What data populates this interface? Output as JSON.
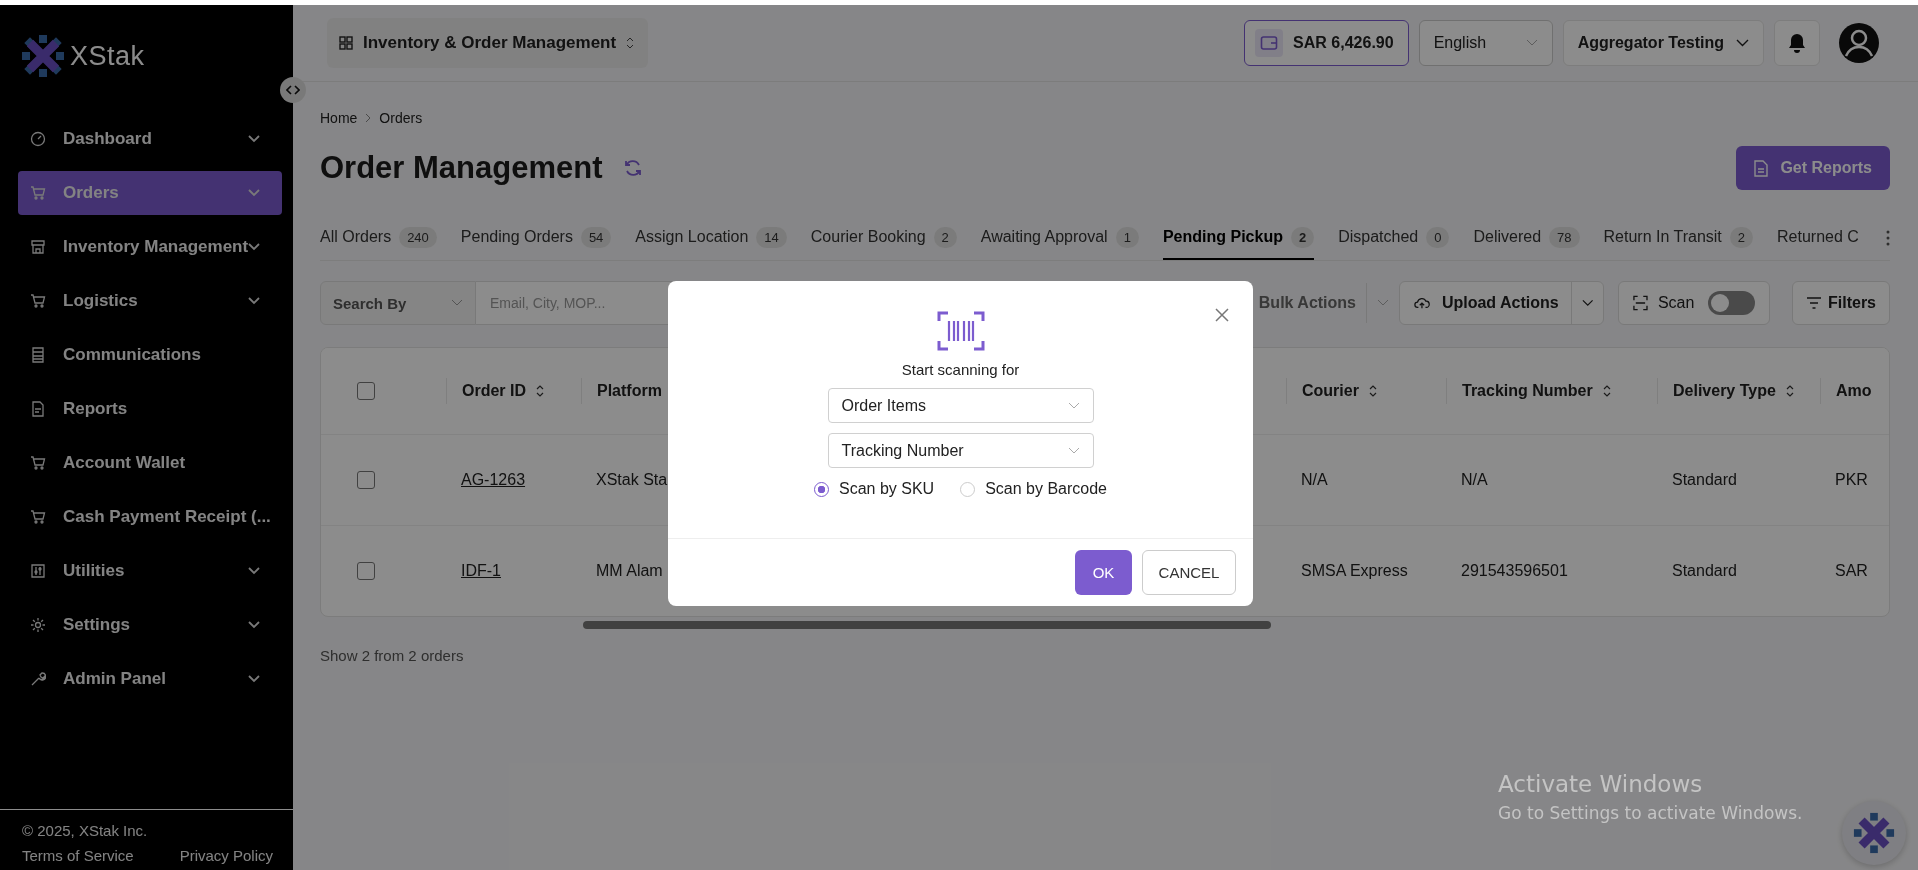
{
  "sidebar": {
    "logo": "XStak",
    "items": [
      {
        "label": "Dashboard",
        "expandable": true,
        "selected": false
      },
      {
        "label": "Orders",
        "expandable": true,
        "selected": true
      },
      {
        "label": "Inventory Management",
        "expandable": true,
        "selected": false
      },
      {
        "label": "Logistics",
        "expandable": true,
        "selected": false
      },
      {
        "label": "Communications",
        "expandable": false,
        "selected": false
      },
      {
        "label": "Reports",
        "expandable": false,
        "selected": false
      },
      {
        "label": "Account Wallet",
        "expandable": false,
        "selected": false
      },
      {
        "label": "Cash Payment Receipt (...",
        "expandable": false,
        "selected": false
      },
      {
        "label": "Utilities",
        "expandable": true,
        "selected": false
      },
      {
        "label": "Settings",
        "expandable": true,
        "selected": false
      },
      {
        "label": "Admin Panel",
        "expandable": true,
        "selected": false
      }
    ],
    "copyright": "© 2025, XStak Inc.",
    "links": [
      "Terms of Service",
      "Privacy Policy"
    ]
  },
  "topbar": {
    "app_switcher": "Inventory & Order Management",
    "wallet": "SAR 6,426.90",
    "language": "English",
    "account": "Aggregator Testing"
  },
  "breadcrumb": [
    "Home",
    "Orders"
  ],
  "title": "Order Management",
  "get_reports": "Get Reports",
  "tabs": [
    {
      "label": "All Orders",
      "count": "240",
      "selected": false
    },
    {
      "label": "Pending Orders",
      "count": "54",
      "selected": false
    },
    {
      "label": "Assign Location",
      "count": "14",
      "selected": false
    },
    {
      "label": "Courier Booking",
      "count": "2",
      "selected": false
    },
    {
      "label": "Awaiting Approval",
      "count": "1",
      "selected": false
    },
    {
      "label": "Pending Pickup",
      "count": "2",
      "selected": true
    },
    {
      "label": "Dispatched",
      "count": "0",
      "selected": false
    },
    {
      "label": "Delivered",
      "count": "78",
      "selected": false
    },
    {
      "label": "Return In Transit",
      "count": "2",
      "selected": false
    },
    {
      "label": "Returned C",
      "selected": false
    }
  ],
  "toolbar": {
    "search_by": "Search By",
    "search": {
      "placeholder": "Email, City, MOP..."
    },
    "bulk_actions": "Bulk Actions",
    "upload_actions": "Upload Actions",
    "scan": {
      "label": "Scan",
      "on": false
    },
    "filters": "Filters"
  },
  "table": {
    "header_checked": false,
    "columns": [
      {
        "label": "Order ID",
        "sortable": true
      },
      {
        "label": "Platform"
      },
      {
        "label": "Courier",
        "sortable": true
      },
      {
        "label": "Tracking Number",
        "sortable": true
      },
      {
        "label": "Delivery Type",
        "sortable": true
      },
      {
        "label": "Amo",
        "sortable": false
      }
    ],
    "rows": [
      {
        "checked": false,
        "cells": [
          "AG-1263",
          "XStak Sta",
          "N/A",
          "N/A",
          "Standard",
          "PKR"
        ]
      },
      {
        "checked": false,
        "cells": [
          "IDF-1",
          "MM Alam",
          "SMSA Express",
          "291543596501",
          "Standard",
          "SAR"
        ]
      }
    ]
  },
  "summary": "Show 2 from 2 orders",
  "modal": {
    "prompt": "Start scanning for",
    "selects": [
      "Order Items",
      "Tracking Number"
    ],
    "radios": [
      {
        "label": "Scan by SKU",
        "selected": true
      },
      {
        "label": "Scan by Barcode",
        "selected": false
      }
    ],
    "ok": "OK",
    "cancel": "CANCEL"
  },
  "os_notice": {
    "title": "Activate Windows",
    "text": "Go to Settings to activate Windows."
  }
}
